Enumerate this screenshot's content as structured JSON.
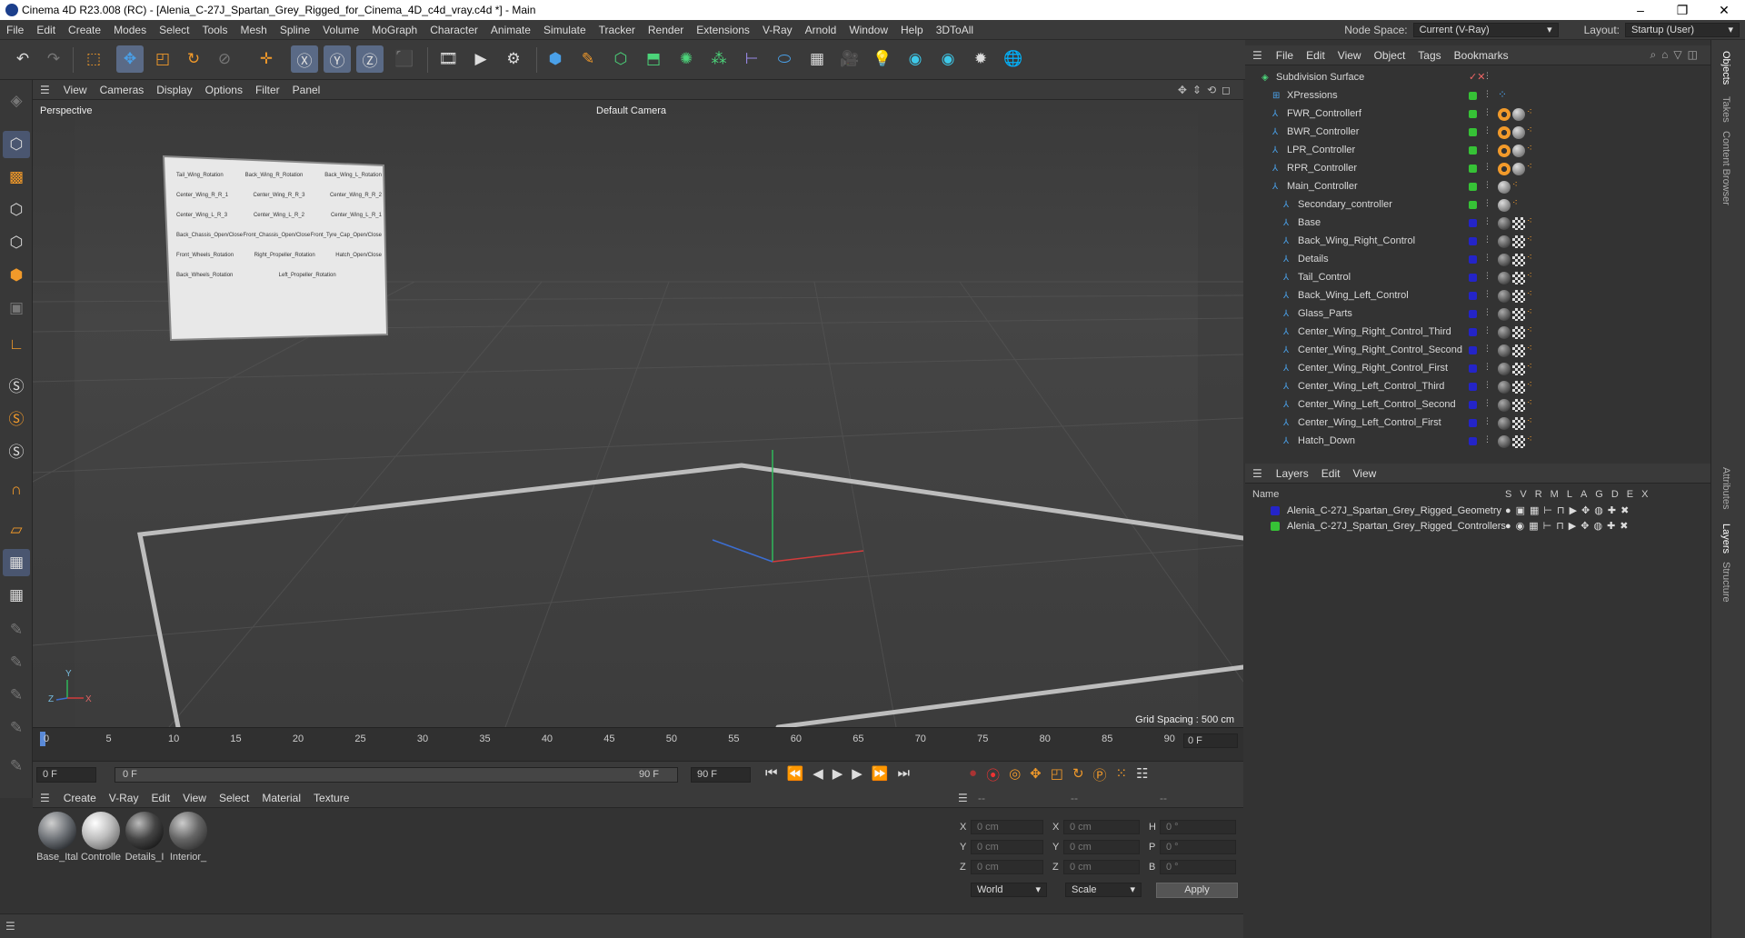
{
  "window": {
    "title": "Cinema 4D R23.008 (RC) - [Alenia_C-27J_Spartan_Grey_Rigged_for_Cinema_4D_c4d_vray.c4d *] - Main",
    "minimize": "–",
    "maximize": "❐",
    "close": "✕"
  },
  "menubar": {
    "items": [
      "File",
      "Edit",
      "Create",
      "Modes",
      "Select",
      "Tools",
      "Mesh",
      "Spline",
      "Volume",
      "MoGraph",
      "Character",
      "Animate",
      "Simulate",
      "Tracker",
      "Render",
      "Extensions",
      "V-Ray",
      "Arnold",
      "Window",
      "Help",
      "3DToAll"
    ],
    "node_space_label": "Node Space:",
    "node_space_value": "Current (V-Ray)",
    "layout_label": "Layout:",
    "layout_value": "Startup (User)"
  },
  "viewport": {
    "menu": [
      "View",
      "Cameras",
      "Display",
      "Options",
      "Filter",
      "Panel"
    ],
    "name": "Perspective",
    "camera": "Default Camera",
    "grid_spacing": "Grid Spacing : 500 cm",
    "axis_y": "Y",
    "axis_z": "Z",
    "axis_x": "X",
    "hud_panel": {
      "rows": [
        [
          "Tail_Wing_Rotation",
          "Back_Wing_R_Rotation",
          "Back_Wing_L_Rotation"
        ],
        [
          "Center_Wing_R_R_1",
          "Center_Wing_R_R_3",
          "Center_Wing_R_R_2"
        ],
        [
          "Center_Wing_L_R_3",
          "Center_Wing_L_R_2",
          "Center_Wing_L_R_1"
        ],
        [
          "Back_Chassis_Open/Close",
          "Front_Chassis_Open/Close",
          "Front_Tyre_Cap_Open/Close"
        ],
        [
          "Front_Wheels_Rotation",
          "Right_Propeller_Rotation",
          "Hatch_Open/Close"
        ],
        [
          "Back_Wheels_Rotation",
          "Left_Propeller_Rotation",
          ""
        ]
      ]
    }
  },
  "timeline": {
    "ticks": [
      "0",
      "5",
      "10",
      "15",
      "20",
      "25",
      "30",
      "35",
      "40",
      "45",
      "50",
      "55",
      "60",
      "65",
      "70",
      "75",
      "80",
      "85",
      "90"
    ],
    "current_frame_right": "0 F",
    "start_field": "0 F",
    "range_start": "0 F",
    "range_end": "90 F",
    "end_field": "90 F"
  },
  "material_manager": {
    "menu": [
      "Create",
      "V-Ray",
      "Edit",
      "View",
      "Select",
      "Material",
      "Texture"
    ],
    "materials": [
      "Base_Ital",
      "Controlle",
      "Details_I",
      "Interior_"
    ]
  },
  "coordinates": {
    "header": [
      "--",
      "--",
      "--"
    ],
    "rows": [
      {
        "a": "X",
        "av": "0 cm",
        "b": "X",
        "bv": "0 cm",
        "c": "H",
        "cv": "0 °"
      },
      {
        "a": "Y",
        "av": "0 cm",
        "b": "Y",
        "bv": "0 cm",
        "c": "P",
        "cv": "0 °"
      },
      {
        "a": "Z",
        "av": "0 cm",
        "b": "Z",
        "bv": "0 cm",
        "c": "B",
        "cv": "0 °"
      }
    ],
    "space": "World",
    "mode": "Scale",
    "apply": "Apply"
  },
  "object_manager": {
    "menu": [
      "File",
      "Edit",
      "View",
      "Object",
      "Tags",
      "Bookmarks"
    ],
    "objects": [
      {
        "name": "Subdivision Surface",
        "indent": 0,
        "color": "",
        "tags": "none"
      },
      {
        "name": "XPressions",
        "indent": 1,
        "color": "#36c236",
        "tags": "xp"
      },
      {
        "name": "FWR_Controllerf",
        "indent": 1,
        "color": "#36c236",
        "tags": "ctrl"
      },
      {
        "name": "BWR_Controller",
        "indent": 1,
        "color": "#36c236",
        "tags": "ctrl"
      },
      {
        "name": "LPR_Controller",
        "indent": 1,
        "color": "#36c236",
        "tags": "ctrl"
      },
      {
        "name": "RPR_Controller",
        "indent": 1,
        "color": "#36c236",
        "tags": "ctrl"
      },
      {
        "name": "Main_Controller",
        "indent": 1,
        "color": "#36c236",
        "tags": "main"
      },
      {
        "name": "Secondary_controller",
        "indent": 2,
        "color": "#36c236",
        "tags": "main"
      },
      {
        "name": "Base",
        "indent": 2,
        "color": "#2424c8",
        "tags": "geo"
      },
      {
        "name": "Back_Wing_Right_Control",
        "indent": 2,
        "color": "#2424c8",
        "tags": "geo"
      },
      {
        "name": "Details",
        "indent": 2,
        "color": "#2424c8",
        "tags": "geo"
      },
      {
        "name": "Tail_Control",
        "indent": 2,
        "color": "#2424c8",
        "tags": "geo"
      },
      {
        "name": "Back_Wing_Left_Control",
        "indent": 2,
        "color": "#2424c8",
        "tags": "geo"
      },
      {
        "name": "Glass_Parts",
        "indent": 2,
        "color": "#2424c8",
        "tags": "geo"
      },
      {
        "name": "Center_Wing_Right_Control_Third",
        "indent": 2,
        "color": "#2424c8",
        "tags": "geo"
      },
      {
        "name": "Center_Wing_Right_Control_Second",
        "indent": 2,
        "color": "#2424c8",
        "tags": "geo"
      },
      {
        "name": "Center_Wing_Right_Control_First",
        "indent": 2,
        "color": "#2424c8",
        "tags": "geo"
      },
      {
        "name": "Center_Wing_Left_Control_Third",
        "indent": 2,
        "color": "#2424c8",
        "tags": "geo"
      },
      {
        "name": "Center_Wing_Left_Control_Second",
        "indent": 2,
        "color": "#2424c8",
        "tags": "geo"
      },
      {
        "name": "Center_Wing_Left_Control_First",
        "indent": 2,
        "color": "#2424c8",
        "tags": "geo"
      },
      {
        "name": "Hatch_Down",
        "indent": 2,
        "color": "#2424c8",
        "tags": "geo"
      }
    ]
  },
  "layer_manager": {
    "menu": [
      "Layers",
      "Edit",
      "View"
    ],
    "columns": [
      "Name",
      "S",
      "V",
      "R",
      "M",
      "L",
      "A",
      "G",
      "D",
      "E",
      "X"
    ],
    "layers": [
      {
        "name": "Alenia_C-27J_Spartan_Grey_Rigged_Geometry",
        "color": "#2424c8"
      },
      {
        "name": "Alenia_C-27J_Spartan_Grey_Rigged_Controllers",
        "color": "#36c236"
      }
    ]
  },
  "right_tabs": [
    "Objects",
    "Takes",
    "Content Browser",
    "Attributes",
    "Layers",
    "Structure"
  ]
}
